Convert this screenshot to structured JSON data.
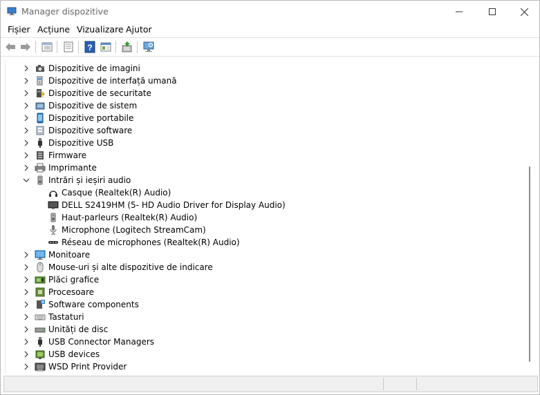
{
  "window": {
    "title": "Manager dispozitive"
  },
  "menu": [
    "Fișier",
    "Acțiune",
    "Vizualizare",
    "Ajutor"
  ],
  "toolbar": [
    "back-icon",
    "forward-icon",
    "properties-view-icon",
    "list-view-icon",
    "help-icon",
    "resources-view-icon",
    "update-driver-icon",
    "scan-hardware-icon"
  ],
  "tree": {
    "items": [
      {
        "label": "Dispozitive de imagini",
        "icon": "camera-icon",
        "level": 0,
        "state": "collapsed"
      },
      {
        "label": "Dispozitive de interfață umană",
        "icon": "hid-icon",
        "level": 0,
        "state": "collapsed"
      },
      {
        "label": "Dispozitive de securitate",
        "icon": "security-key-icon",
        "level": 0,
        "state": "collapsed"
      },
      {
        "label": "Dispozitive de sistem",
        "icon": "system-device-icon",
        "level": 0,
        "state": "collapsed"
      },
      {
        "label": "Dispozitive portabile",
        "icon": "portable-device-icon",
        "level": 0,
        "state": "collapsed"
      },
      {
        "label": "Dispozitive software",
        "icon": "software-device-icon",
        "level": 0,
        "state": "collapsed"
      },
      {
        "label": "Dispozitive USB",
        "icon": "usb-icon",
        "level": 0,
        "state": "collapsed"
      },
      {
        "label": "Firmware",
        "icon": "firmware-icon",
        "level": 0,
        "state": "collapsed"
      },
      {
        "label": "Imprimante",
        "icon": "printer-icon",
        "level": 0,
        "state": "collapsed"
      },
      {
        "label": "Intrări și ieșiri audio",
        "icon": "speaker-icon",
        "level": 0,
        "state": "expanded"
      },
      {
        "label": "Casque (Realtek(R) Audio)",
        "icon": "headphones-icon",
        "level": 1,
        "state": "leaf"
      },
      {
        "label": "DELL S2419HM (5- HD Audio Driver for Display Audio)",
        "icon": "monitor-audio-icon",
        "level": 1,
        "state": "leaf"
      },
      {
        "label": "Haut-parleurs (Realtek(R) Audio)",
        "icon": "speaker-icon",
        "level": 1,
        "state": "leaf"
      },
      {
        "label": "Microphone (Logitech StreamCam)",
        "icon": "microphone-icon",
        "level": 1,
        "state": "leaf"
      },
      {
        "label": "Réseau de microphones (Realtek(R) Audio)",
        "icon": "microphone-array-icon",
        "level": 1,
        "state": "leaf"
      },
      {
        "label": "Monitoare",
        "icon": "monitor-icon",
        "level": 0,
        "state": "collapsed"
      },
      {
        "label": "Mouse-uri și alte dispozitive de indicare",
        "icon": "mouse-icon",
        "level": 0,
        "state": "collapsed"
      },
      {
        "label": "Plăci grafice",
        "icon": "display-adapter-icon",
        "level": 0,
        "state": "collapsed"
      },
      {
        "label": "Procesoare",
        "icon": "processor-icon",
        "level": 0,
        "state": "collapsed"
      },
      {
        "label": "Software components",
        "icon": "software-component-icon",
        "level": 0,
        "state": "collapsed"
      },
      {
        "label": "Tastaturi",
        "icon": "keyboard-icon",
        "level": 0,
        "state": "collapsed"
      },
      {
        "label": "Unități de disc",
        "icon": "disk-drive-icon",
        "level": 0,
        "state": "collapsed"
      },
      {
        "label": "USB Connector Managers",
        "icon": "usb-icon",
        "level": 0,
        "state": "collapsed"
      },
      {
        "label": "USB devices",
        "icon": "usb-device-icon",
        "level": 0,
        "state": "collapsed"
      },
      {
        "label": "WSD Print Provider",
        "icon": "wsd-printer-icon",
        "level": 0,
        "state": "collapsed"
      }
    ]
  },
  "colors": {
    "accent": "#0067c0",
    "monitor_blue": "#2f8fd8",
    "chip_green": "#5a8f2e"
  }
}
